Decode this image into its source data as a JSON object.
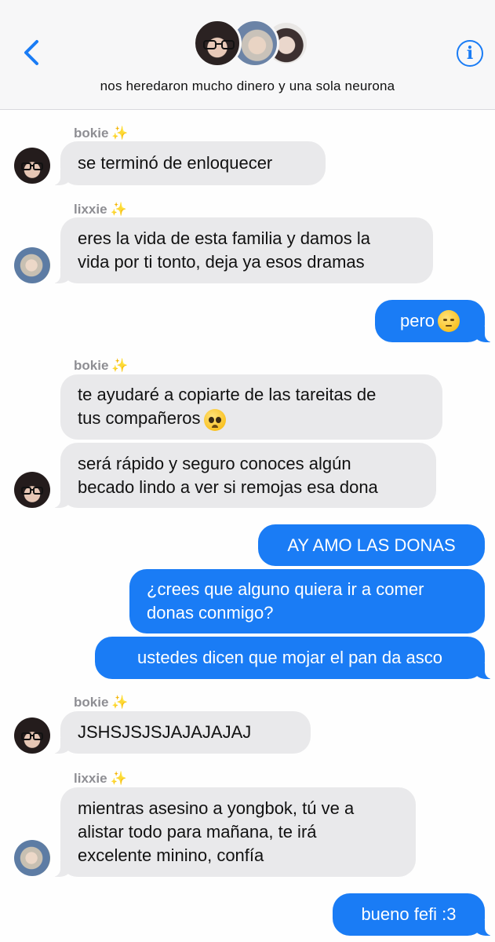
{
  "header": {
    "group_name": "nos heredaron mucho dinero y una sola neurona",
    "back_icon": "chevron-left-icon",
    "info_label": "i",
    "accent_color": "#1a7cf5"
  },
  "colors": {
    "incoming_bubble": "#e9e9eb",
    "outgoing_bubble": "#1a7cf5",
    "sender_label": "#8e8e93"
  },
  "messages": {
    "s1": {
      "sender": "bokie",
      "sparkle": "✨"
    },
    "m1": "se terminó de enloquecer",
    "s2": {
      "sender": "lixxie",
      "sparkle": "✨"
    },
    "m2a": "eres la vida de esta familia y damos la",
    "m2b": "vida por ti tonto, deja ya esos dramas",
    "m3": "pero",
    "m3_emoji": "pensive-face-emoji",
    "s3": {
      "sender": "bokie",
      "sparkle": "✨"
    },
    "m4a": "te ayudaré a copiarte de las tareitas de",
    "m4b": "tus compañeros",
    "m4_emoji": "pleading-face-emoji",
    "m5a": "será rápido y seguro conoces algún",
    "m5b": "becado lindo a ver si remojas esa dona",
    "m6": "AY AMO LAS DONAS",
    "m7a": "¿crees que alguno quiera ir a comer",
    "m7b": "donas conmigo?",
    "m8": "ustedes dicen que mojar el pan da asco",
    "s4": {
      "sender": "bokie",
      "sparkle": "✨"
    },
    "m9": "JSHSJSJSJAJAJAJAJ",
    "s5": {
      "sender": "lixxie",
      "sparkle": "✨"
    },
    "m10a": "mientras asesino a yongbok, tú ve a",
    "m10b": "alistar todo para mañana, te irá",
    "m10c": "excelente minino, confía",
    "m11": "bueno fefi :3"
  }
}
